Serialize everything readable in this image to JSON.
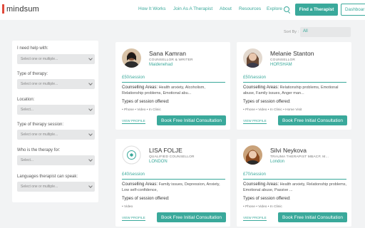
{
  "header": {
    "logo_text": "mindsum",
    "nav": [
      "How It Works",
      "Join As A Therapist",
      "About",
      "Resources",
      "Explore"
    ],
    "find_button": "Find a Therapist",
    "dashboard_button": "Dashboar"
  },
  "sort": {
    "label": "Sort By :",
    "value": "All"
  },
  "filters": [
    {
      "label": "I need help with:",
      "placeholder": "Select one or multiple..."
    },
    {
      "label": "Type of therapy:",
      "placeholder": "Select one or multiple..."
    },
    {
      "label": "Location:",
      "placeholder": "Select..."
    },
    {
      "label": "Type of therapy session:",
      "placeholder": "Select one or multiple..."
    },
    {
      "label": "Who is the therapy for:",
      "placeholder": "Select..."
    },
    {
      "label": "Languages therapist can speak:",
      "placeholder": "Select one or multiple..."
    }
  ],
  "cards": [
    {
      "name": "Sana Kamran",
      "role": "COUNSELLOR & WRITER",
      "location": "Maidenehad",
      "price": "£50/session",
      "areas_label": "Counselling Areas:",
      "areas": "Health anxiety, Alcoholism, Relationship problems, Emotional abu...",
      "types_label": "Types of session offered:",
      "types": "• Phone   • Video   • In Clinic",
      "view": "VIEW PROFILE",
      "book": "Book Free Initial Consultation"
    },
    {
      "name": "Melanie Stanton",
      "role": "COUNSELLOR",
      "location": "HORSHAM",
      "price": "£50/session",
      "areas_label": "Counselling Areas:",
      "areas": "Relationship problems, Emotional abuse, Family issues, Anger man...",
      "types_label": "Types of session offered:",
      "types": "• Phone   • Video   • In Clinic   • Home Visit",
      "view": "VIEW PROFILE",
      "book": "Book Free Initial Consultation"
    },
    {
      "name": "LISA FOLJE",
      "role": "QUALIFIED COUNSELLOR",
      "location": "LONDON",
      "price": "£40/session",
      "areas_label": "Counselling Areas:",
      "areas": "Family issues, Depression, Anxiety, Low self-confidence,",
      "types_label": "Types of session offered:",
      "types": "• Video",
      "view": "VIEW PROFILE",
      "book": "Book Free Initial Consultation"
    },
    {
      "name": "Silvi Neykova",
      "role": "TRAUMA THERAPIST MBACP, M...",
      "location": "London",
      "price": "£70/session",
      "areas_label": "Counselling Areas:",
      "areas": "Health anxiety, Relationship problems, Emotional abuse, Passive ...",
      "types_label": "Types of session offered:",
      "types": "• Phone   • Video   • In Clinic",
      "view": "VIEW PROFILE",
      "book": "Book Free Initial Consultation"
    }
  ]
}
